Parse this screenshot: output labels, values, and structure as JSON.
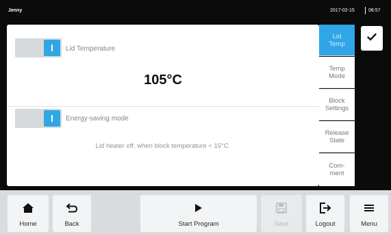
{
  "status_bar": {
    "user": "Jenny",
    "date": "2017-02-15",
    "time": "08:57"
  },
  "lid_temperature": {
    "label": "Lid Temperature",
    "value": "105°C",
    "enabled": true
  },
  "energy_saving": {
    "label": "Energy-saving mode",
    "enabled": true,
    "note": "Lid heater off, when block temperature < 15°C."
  },
  "side_tabs": [
    {
      "label": "Lid\nTemp",
      "active": true
    },
    {
      "label": "Temp\nMode",
      "active": false
    },
    {
      "label": "Block\nSettings",
      "active": false
    },
    {
      "label": "Release\nState",
      "active": false
    },
    {
      "label": "Com-\nment",
      "active": false
    }
  ],
  "toolbar": {
    "home_label": "Home",
    "back_label": "Back",
    "start_label": "Start Program",
    "save_label": "Save",
    "logout_label": "Logout",
    "menu_label": "Menu"
  },
  "colors": {
    "accent": "#2fa6e6",
    "background": "#0b0b0b",
    "toolbar": "#d9dcdf"
  },
  "icons": {
    "confirm": "check-icon",
    "home": "home-icon",
    "back": "back-arrow-icon",
    "start": "play-icon",
    "save": "floppy-disk-icon",
    "logout": "logout-icon",
    "menu": "hamburger-menu-icon"
  }
}
